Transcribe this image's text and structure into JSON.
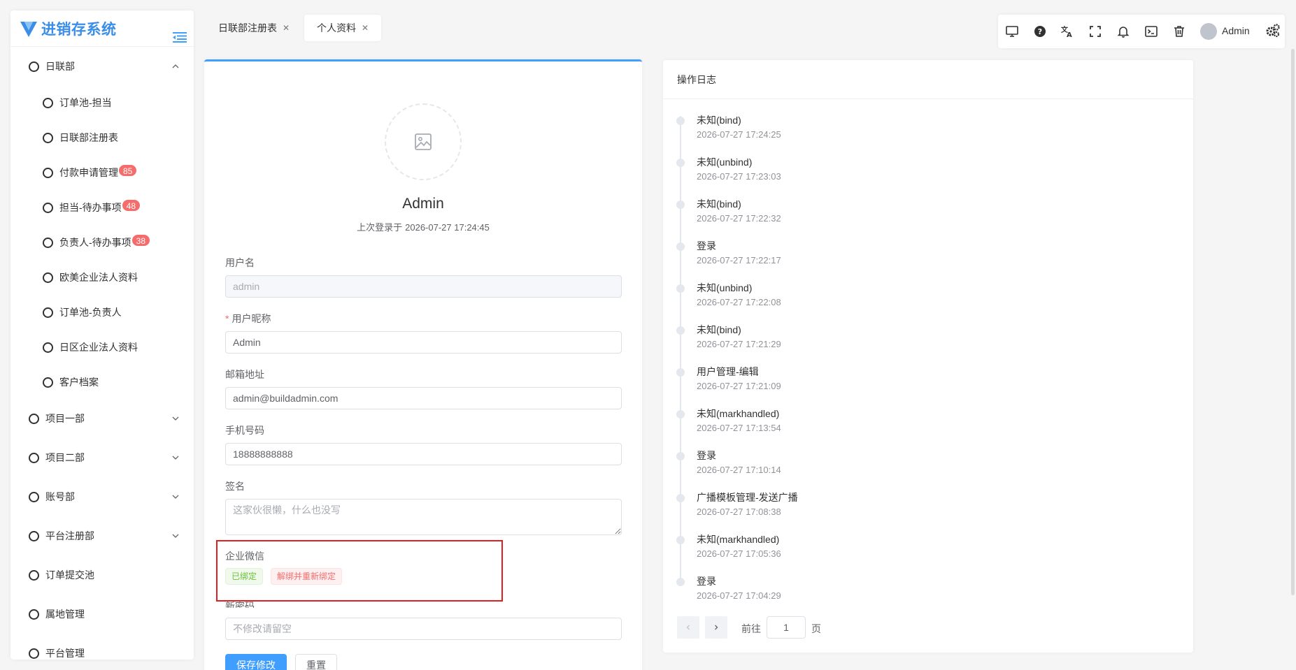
{
  "app": {
    "title": "进销存系统"
  },
  "sidebar": {
    "items": [
      {
        "label": "日联部",
        "level": 1,
        "expanded": true
      },
      {
        "label": "订单池-担当",
        "level": 2
      },
      {
        "label": "日联部注册表",
        "level": 2
      },
      {
        "label": "付款申请管理",
        "level": 2,
        "badge": "85"
      },
      {
        "label": "担当-待办事项",
        "level": 2,
        "badge": "48"
      },
      {
        "label": "负责人-待办事项",
        "level": 2,
        "badge": "38"
      },
      {
        "label": "欧美企业法人资料",
        "level": 2
      },
      {
        "label": "订单池-负责人",
        "level": 2
      },
      {
        "label": "日区企业法人资料",
        "level": 2
      },
      {
        "label": "客户档案",
        "level": 2
      },
      {
        "label": "项目一部",
        "level": 1,
        "expanded": false
      },
      {
        "label": "项目二部",
        "level": 1,
        "expanded": false
      },
      {
        "label": "账号部",
        "level": 1,
        "expanded": false
      },
      {
        "label": "平台注册部",
        "level": 1,
        "expanded": false
      },
      {
        "label": "订单提交池",
        "level": 1
      },
      {
        "label": "属地管理",
        "level": 1
      },
      {
        "label": "平台管理",
        "level": 1
      }
    ]
  },
  "tabs": [
    {
      "label": "日联部注册表",
      "active": false
    },
    {
      "label": "个人资料",
      "active": true
    }
  ],
  "toolbar": {
    "icons": [
      "monitor-icon",
      "help-icon",
      "translate-icon",
      "fullscreen-icon",
      "bell-icon",
      "terminal-icon",
      "trash-icon"
    ],
    "user": "Admin",
    "settings_icon": "gears-icon"
  },
  "profile": {
    "name": "Admin",
    "last_login_label": "上次登录于",
    "last_login_time": "2026-07-27 17:24:45",
    "fields": {
      "username": {
        "label": "用户名",
        "value": "admin"
      },
      "nickname": {
        "label": "用户昵称",
        "value": "Admin",
        "required": "*"
      },
      "email": {
        "label": "邮箱地址",
        "value": "admin@buildadmin.com"
      },
      "mobile": {
        "label": "手机号码",
        "value": "18888888888"
      },
      "signature": {
        "label": "签名",
        "placeholder": "这家伙很懒，什么也没写"
      },
      "wechat": {
        "label": "企业微信",
        "bound_tag": "已绑定",
        "rebind_tag": "解绑并重新绑定"
      },
      "password": {
        "label": "新密码",
        "placeholder": "不修改请留空"
      }
    },
    "buttons": {
      "save": "保存修改",
      "reset": "重置"
    }
  },
  "log": {
    "title": "操作日志",
    "items": [
      {
        "title": "未知(bind)",
        "time": "2026-07-27 17:24:25"
      },
      {
        "title": "未知(unbind)",
        "time": "2026-07-27 17:23:03"
      },
      {
        "title": "未知(bind)",
        "time": "2026-07-27 17:22:32"
      },
      {
        "title": "登录",
        "time": "2026-07-27 17:22:17"
      },
      {
        "title": "未知(unbind)",
        "time": "2026-07-27 17:22:08"
      },
      {
        "title": "未知(bind)",
        "time": "2026-07-27 17:21:29"
      },
      {
        "title": "用户管理-编辑",
        "time": "2026-07-27 17:21:09"
      },
      {
        "title": "未知(markhandled)",
        "time": "2026-07-27 17:13:54"
      },
      {
        "title": "登录",
        "time": "2026-07-27 17:10:14"
      },
      {
        "title": "广播模板管理-发送广播",
        "time": "2026-07-27 17:08:38"
      },
      {
        "title": "未知(markhandled)",
        "time": "2026-07-27 17:05:36"
      },
      {
        "title": "登录",
        "time": "2026-07-27 17:04:29"
      }
    ],
    "pager": {
      "goto_label": "前往",
      "page": "1",
      "page_unit": "页"
    }
  },
  "colors": {
    "primary": "#409eff",
    "danger": "#f56c6c",
    "success": "#67c23a",
    "highlight": "#e02020"
  }
}
